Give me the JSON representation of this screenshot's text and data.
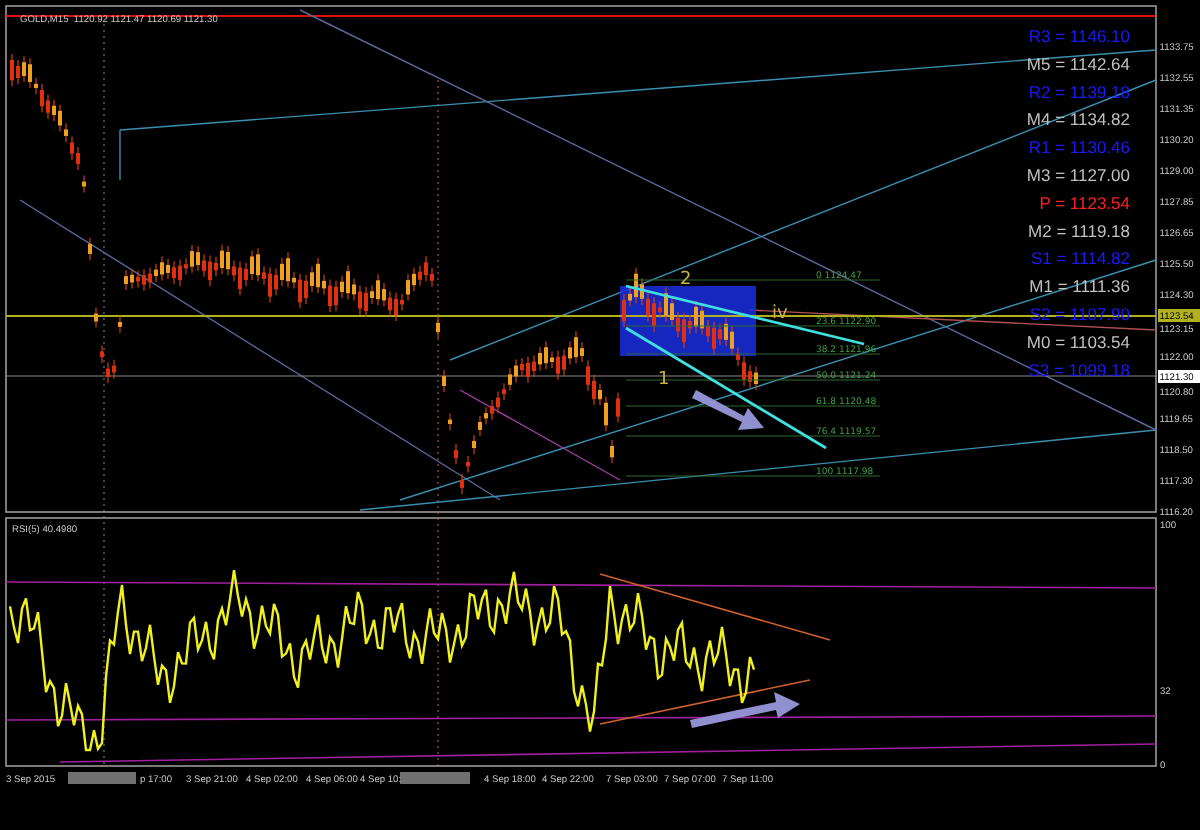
{
  "chart_window": {
    "title": "GOLD,M15  1120.92 1121.47 1120.69 1121.30"
  },
  "pivot_levels": [
    {
      "label": "R3 = 1146.10",
      "color": "#1a1aff"
    },
    {
      "label": "M5 = 1142.64",
      "color": "#c0c0c0"
    },
    {
      "label": "R2 = 1139.18",
      "color": "#1a1aff"
    },
    {
      "label": "M4 = 1134.82",
      "color": "#c0c0c0"
    },
    {
      "label": "R1 = 1130.46",
      "color": "#1a1aff"
    },
    {
      "label": "M3 = 1127.00",
      "color": "#c0c0c0"
    },
    {
      "label": "P  = 1123.54",
      "color": "#ff2020"
    },
    {
      "label": "M2 = 1119.18",
      "color": "#c0c0c0"
    },
    {
      "label": "S1 = 1114.82",
      "color": "#1a1aff"
    },
    {
      "label": "M1 = 1111.36",
      "color": "#c0c0c0"
    },
    {
      "label": "S2 = 1107.90",
      "color": "#1a1aff"
    },
    {
      "label": "M0 = 1103.54",
      "color": "#c0c0c0"
    },
    {
      "label": "S3 = 1099.18",
      "color": "#1a1aff"
    }
  ],
  "price_axis": {
    "labels": [
      "1133.75",
      "1132.55",
      "1131.35",
      "1130.20",
      "1129.00",
      "1127.85",
      "1126.65",
      "1125.50",
      "1124.30",
      "1123.15",
      "1122.00",
      "1120.80",
      "1119.65",
      "1118.50",
      "1117.30",
      "1116.20"
    ],
    "pivot_marker": "1123.54",
    "current_price": "1121.30"
  },
  "fibonacci_labels": [
    "0 1124.47",
    "23.6 1122.90",
    "38.2 1121.96",
    "50.0 1121.24",
    "61.8 1120.48",
    "76.4 1119.57",
    "100 1117.98"
  ],
  "wave_labels": [
    "2",
    "1",
    "iv"
  ],
  "rsi_panel": {
    "title": "RSI(5) 40.4980",
    "axis_labels": [
      "100",
      "32",
      "0"
    ]
  },
  "time_axis": [
    "3 Sep 2015",
    "p 17:00",
    "3 Sep 21:00",
    "4 Sep 02:00",
    "4 Sep 06:00",
    "4 Sep 10:",
    "4 Sep 18:00",
    "4 Sep 22:00",
    "7 Sep 03:00",
    "7 Sep 07:00",
    "7 Sep 11:00"
  ]
}
